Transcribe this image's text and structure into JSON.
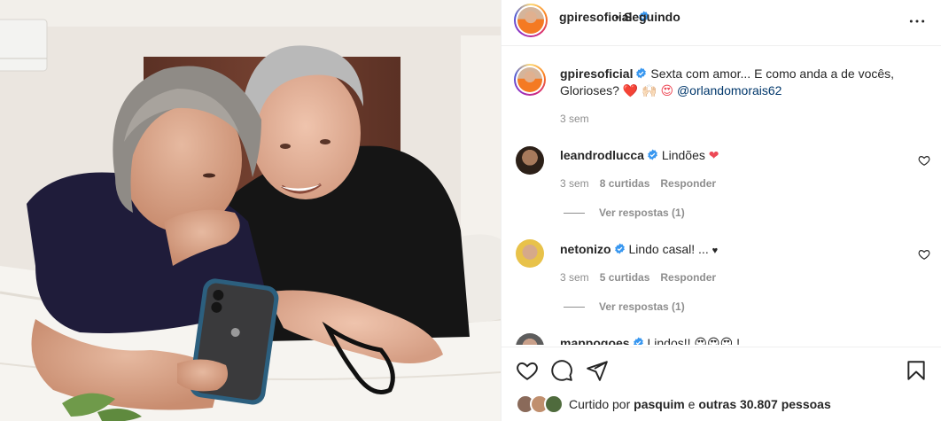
{
  "post": {
    "image_alt": "Casal deitado olhando para um celular",
    "author": "gpiresoficial",
    "dot": "•",
    "following_label": "Seguindo"
  },
  "caption": {
    "username": "gpiresoficial",
    "text": "Sexta com amor... E como anda a de vocês, Glorioses?",
    "emojis": "❤️ 🙌🏻 😍",
    "mention": "@orlandomorais62",
    "time": "3 sem"
  },
  "comments": [
    {
      "username": "leandrodlucca",
      "text": "Lindões",
      "emoji": "❤",
      "time": "3 sem",
      "likes": "8 curtidas",
      "reply_label": "Responder",
      "view_replies": "Ver respostas (1)"
    },
    {
      "username": "netonizo",
      "text": "Lindo casal! ...",
      "emoji": "♥",
      "time": "3 sem",
      "likes": "5 curtidas",
      "reply_label": "Responder",
      "view_replies": "Ver respostas (1)"
    },
    {
      "username": "mappogoes",
      "text": "Lindos!!",
      "emoji": "😍😍😍 !"
    }
  ],
  "footer": {
    "liked_prefix": "Curtido por",
    "liked_user": "pasquim",
    "liked_mid": "e",
    "liked_others": "outras 30.807 pessoas"
  },
  "colors": {
    "verified": "#3897f0",
    "heart": "#ed4956",
    "mention": "#00376b",
    "meta": "#8e8e8e"
  }
}
